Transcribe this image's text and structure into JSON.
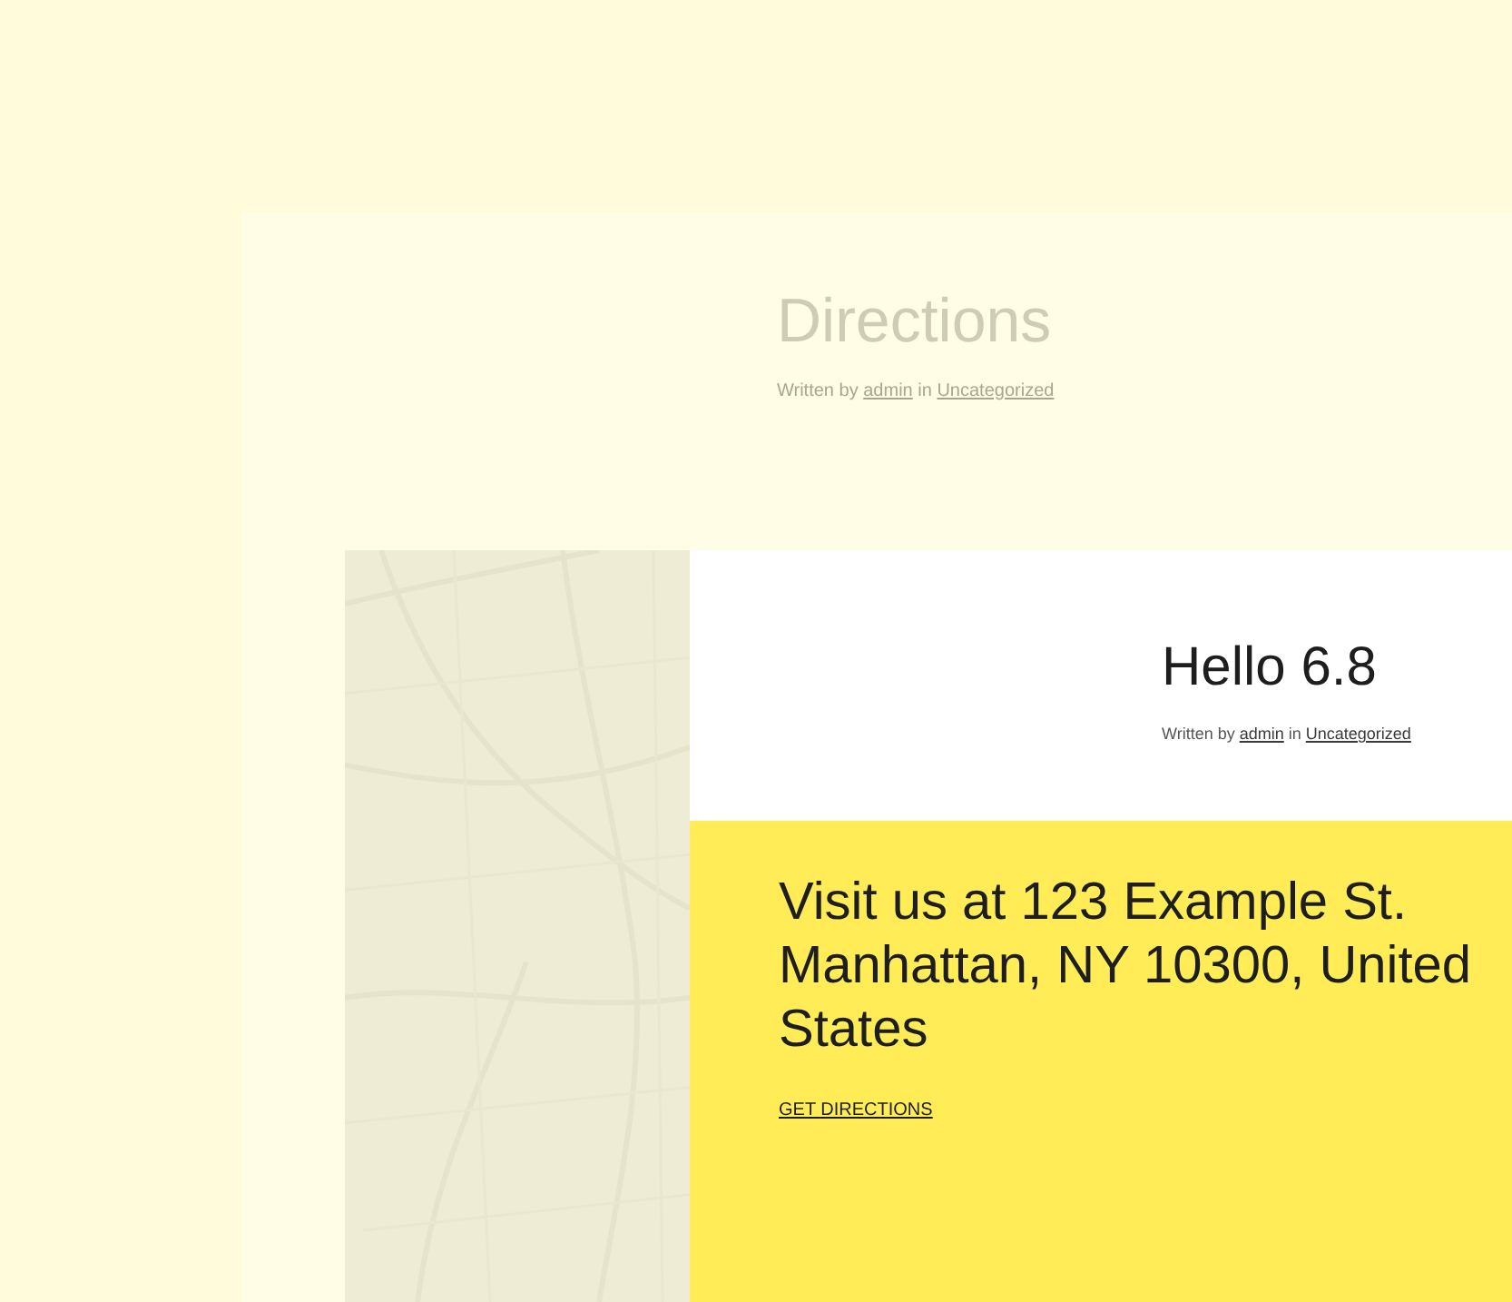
{
  "page": {
    "title": "Directions",
    "meta": {
      "written_by": "Written by",
      "author": "admin",
      "in": "in",
      "category": "Uncategorized"
    }
  },
  "post": {
    "title": "Hello 6.8",
    "meta": {
      "written_by": "Written by",
      "author": "admin",
      "in": "in",
      "category": "Uncategorized"
    }
  },
  "callout": {
    "text": "Visit us at 123 Example St. Manhattan, NY 10300, United States",
    "link": "GET DIRECTIONS"
  }
}
